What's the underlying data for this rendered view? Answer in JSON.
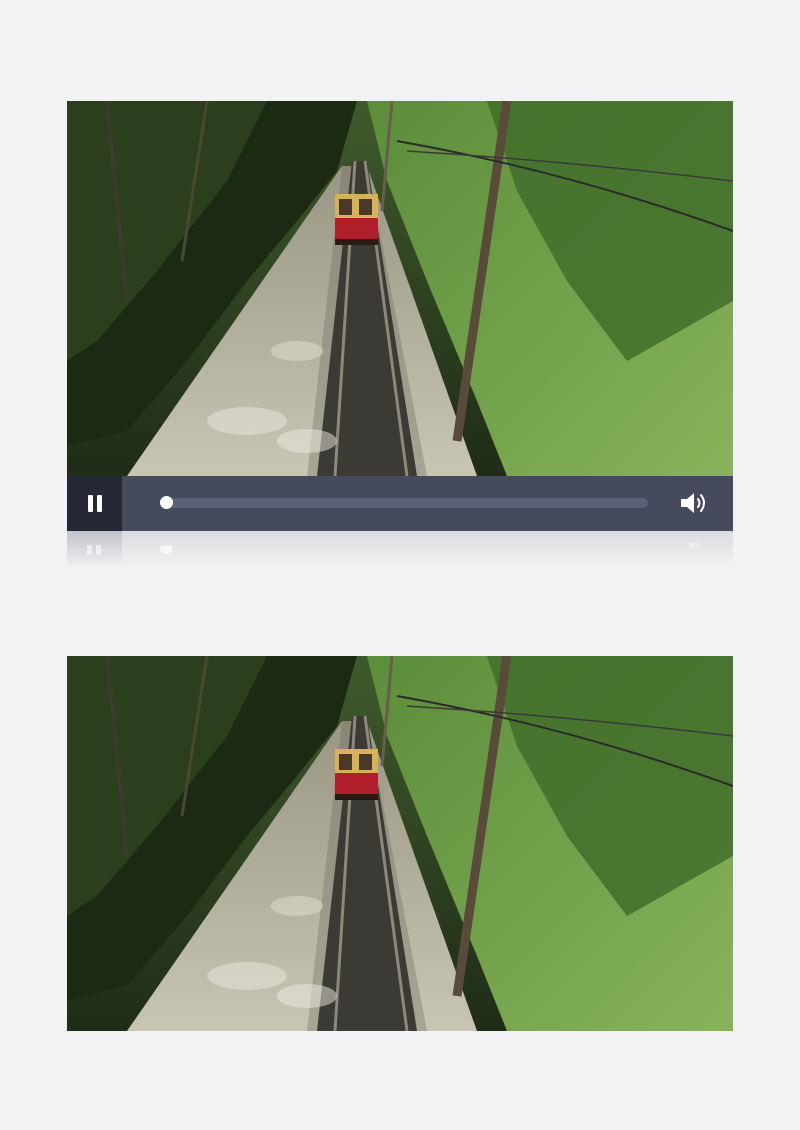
{
  "player": {
    "progress_fraction": 0.0,
    "state": "playing",
    "play_button_icon": "pause-icon",
    "volume_icon": "volume-icon"
  },
  "colors": {
    "control_bar": "#454a5c",
    "play_button_bg": "#252936",
    "track": "#5b6074",
    "knob": "#ffffff"
  }
}
